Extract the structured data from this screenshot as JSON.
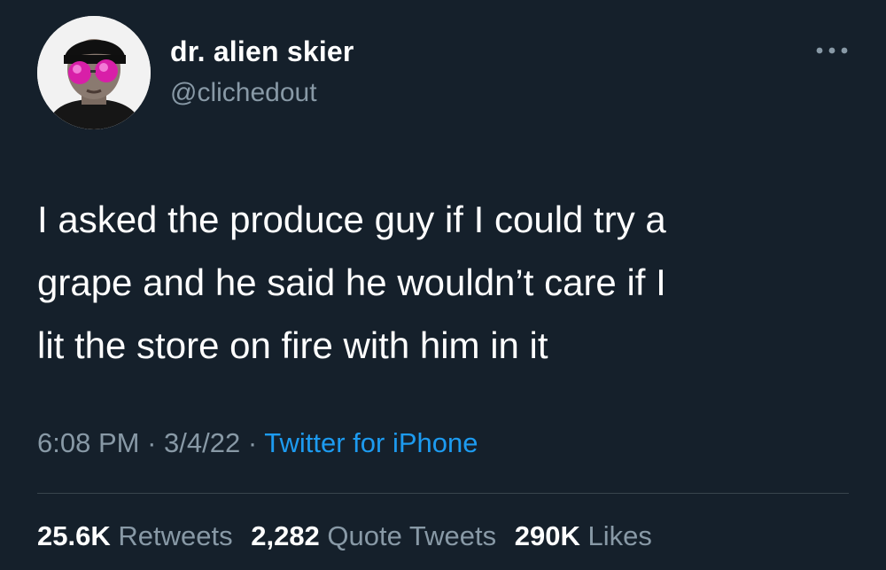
{
  "user": {
    "display_name": "dr. alien skier",
    "handle": "@clichedout",
    "avatar_icon": "profile-photo-pink-sunglasses"
  },
  "tweet": {
    "text": "I asked the produce guy if I could try a\ngrape and he said he wouldn’t care if I\nlit the store on fire with him in it",
    "time": "6:08 PM",
    "date": "3/4/22",
    "separator": "·",
    "source": "Twitter for iPhone"
  },
  "stats": {
    "retweets_count": "25.6K",
    "retweets_label": "Retweets",
    "quotes_count": "2,282",
    "quotes_label": "Quote Tweets",
    "likes_count": "290K",
    "likes_label": "Likes"
  },
  "colors": {
    "background": "#15202b",
    "secondary_text": "#8899a6",
    "link": "#1d9bf0",
    "divider": "#38444d"
  },
  "icons": {
    "more": "more-horizontal-icon"
  }
}
